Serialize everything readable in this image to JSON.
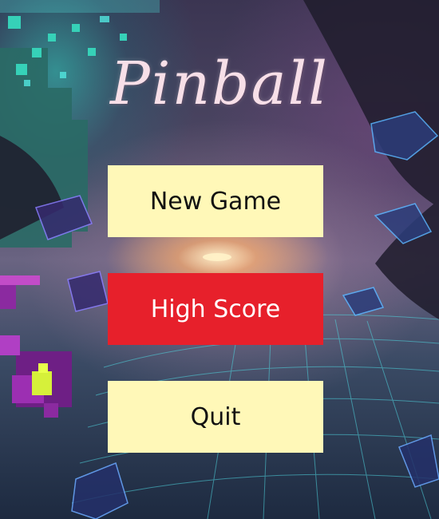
{
  "title": "Pinball",
  "menu": {
    "new_game_label": "New Game",
    "high_score_label": "High Score",
    "quit_label": "Quit",
    "selected": "High Score"
  },
  "colors": {
    "button_default": "#fff8b8",
    "button_selected": "#e7202b",
    "title_color": "#f7dfe8"
  }
}
